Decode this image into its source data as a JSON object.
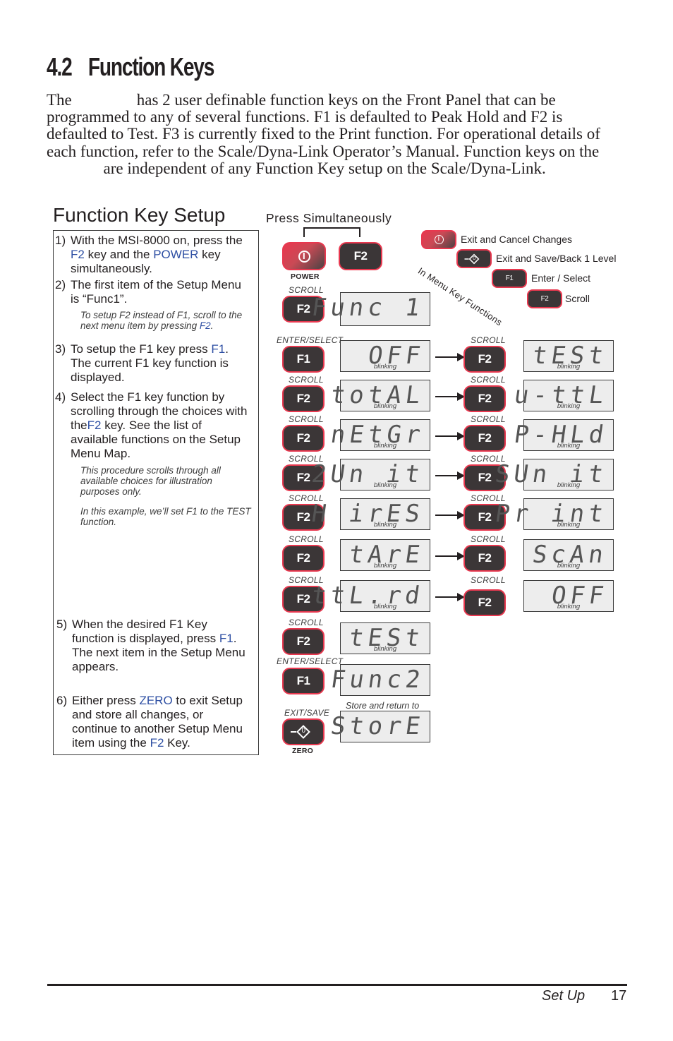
{
  "section": {
    "number": "4.2",
    "title": "Function Keys"
  },
  "intro": {
    "text_lines": [
      "The                has 2 user definable function keys on the Front Panel that can be",
      "programmed to any of several functions. F1 is defaulted to Peak Hold and F2 is",
      "defaulted to Test. F3 is currently fixed to the Print function. For operational details of",
      "each function, refer to the Scale/Dyna-Link Operator’s Manual. Function keys on the",
      "              are independent of any Function Key setup on the Scale/Dyna-Link."
    ]
  },
  "setup": {
    "title": "Function Key Setup",
    "steps": {
      "s1": {
        "num": "1)",
        "a": "With the MSI-8000 on, press the",
        "f2": "F2",
        "b": " key and the ",
        "power": "POWER",
        "c": " key",
        "d": "simultaneously."
      },
      "s2": {
        "num": "2)",
        "a": "The first item of the Setup Menu",
        "b": "is “Func1”."
      },
      "note1": {
        "a": "To setup F2 instead of F1, scroll to the",
        "b": "next menu item by pressing ",
        "f2": "F2",
        "c": "."
      },
      "s3": {
        "num": "3)",
        "a": "To setup the F1 key press ",
        "f1": "F1",
        "b": ".",
        "c": "The current F1 key function is",
        "d": "displayed."
      },
      "s4": {
        "num": "4)",
        "a": "Select the F1 key function by",
        "b": "scrolling through the choices with",
        "c": "the",
        "f2": "F2",
        "d": " key. See the list of",
        "e": "available functions on the Setup",
        "f": "Menu Map."
      },
      "note2": {
        "a": "This procedure scrolls through all",
        "b": "available choices for illustration",
        "c": "purposes only."
      },
      "note3": {
        "a": "In this example, we’ll set F1 to the TEST",
        "b": "function."
      },
      "s5": {
        "num": "5)",
        "a": "When the desired F1 Key",
        "b": "function is displayed, press ",
        "f1": "F1",
        "c": ".",
        "d": "The next item in the Setup Menu",
        "e": "appears."
      },
      "s6": {
        "num": "6)",
        "a": "Either press ",
        "zero": "ZERO",
        "b": " to exit Setup",
        "c": "and store all changes, or",
        "d": "continue to another Setup Menu",
        "e": "item using the ",
        "f2": "F2",
        "f": " Key."
      }
    }
  },
  "diagram": {
    "press_simultaneously": "Press Simultaneously",
    "power_key_label": "POWER",
    "zero_key_label": "ZERO",
    "zero_key_glyph": "0",
    "f1": "F1",
    "f2": "F2",
    "labels": {
      "scroll": "SCROLL",
      "enter_select": "ENTER/SELECT",
      "exit_save": "EXIT/SAVE",
      "blinking": "blinking",
      "store_return": "Store and return to"
    },
    "legend": {
      "title": "In Menu Key Functions",
      "items": [
        {
          "key": "power",
          "text": "Exit and Cancel Changes"
        },
        {
          "key": "zero",
          "text": "Exit and Save/Back 1 Level"
        },
        {
          "key": "F1",
          "text": "Enter / Select"
        },
        {
          "key": "F2",
          "text": "Scroll"
        }
      ]
    },
    "lcd": {
      "func1": "Func 1",
      "left_col": [
        "OFF",
        "totAL",
        "nEtGr",
        "2Un it",
        "H irES",
        "tArE",
        "ttL.rd",
        "tESt"
      ],
      "right_col": [
        "tESt",
        "u-ttL",
        "P-HLd",
        "SUn it",
        "Pr int",
        "ScAn",
        "OFF"
      ],
      "func2": "Func2",
      "store": "StorE"
    }
  },
  "footer": {
    "section": "Set Up",
    "page": "17"
  },
  "colors": {
    "accent_red": "#e8384f",
    "key_dark": "#3b3637",
    "link_blue": "#2e4fa3",
    "lcd_bg": "#ededed"
  }
}
